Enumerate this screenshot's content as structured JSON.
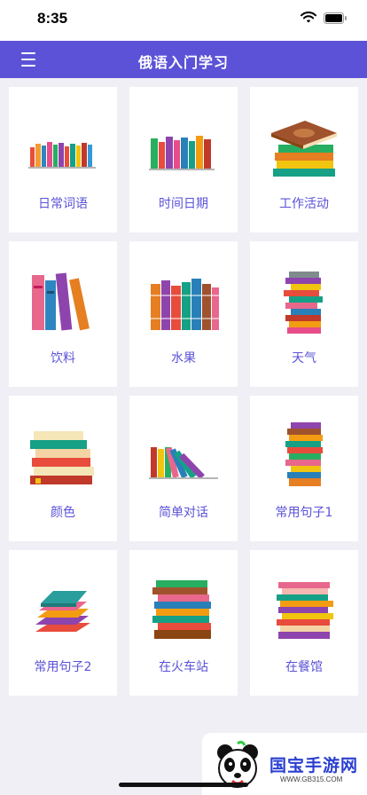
{
  "status_bar": {
    "time": "8:35"
  },
  "nav": {
    "title": "俄语入门学习",
    "menu_icon": "hamburger-menu-icon"
  },
  "categories": [
    {
      "label": "日常词语",
      "illustration": "book-row-thin-icon"
    },
    {
      "label": "时间日期",
      "illustration": "book-row-icon"
    },
    {
      "label": "工作活动",
      "illustration": "book-stack-icon"
    },
    {
      "label": "饮料",
      "illustration": "tall-books-icon"
    },
    {
      "label": "水果",
      "illustration": "book-row-thick-icon"
    },
    {
      "label": "天气",
      "illustration": "book-tower-icon"
    },
    {
      "label": "颜色",
      "illustration": "book-stack-with-bookmark-icon"
    },
    {
      "label": "简单对话",
      "illustration": "leaning-books-icon"
    },
    {
      "label": "常用句子1",
      "illustration": "book-tower-tall-icon"
    },
    {
      "label": "常用句子2",
      "illustration": "small-book-stack-icon"
    },
    {
      "label": "在火车站",
      "illustration": "book-stack-tall-icon"
    },
    {
      "label": "在餐馆",
      "illustration": "book-tower-pastel-icon"
    }
  ],
  "watermark": {
    "brand": "国宝手游网",
    "url": "WWW.GB315.COM"
  },
  "colors": {
    "primary": "#5b52d7",
    "background": "#f0eff5",
    "card": "#ffffff"
  }
}
